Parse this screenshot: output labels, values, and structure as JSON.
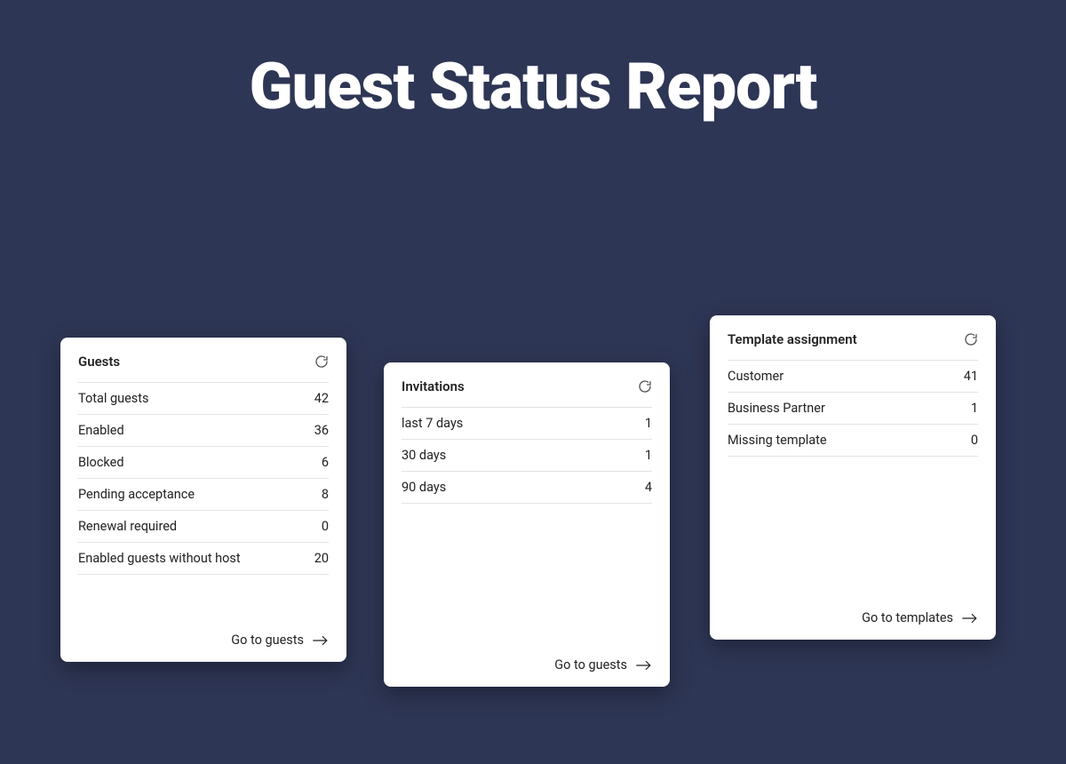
{
  "title": "Guest Status Report",
  "cards": {
    "guests": {
      "title": "Guests",
      "rows": [
        {
          "label": "Total guests",
          "value": "42"
        },
        {
          "label": "Enabled",
          "value": "36"
        },
        {
          "label": "Blocked",
          "value": "6"
        },
        {
          "label": "Pending acceptance",
          "value": "8"
        },
        {
          "label": "Renewal required",
          "value": "0"
        },
        {
          "label": "Enabled guests without host",
          "value": "20"
        }
      ],
      "link": "Go to guests"
    },
    "invitations": {
      "title": "Invitations",
      "rows": [
        {
          "label": "last 7 days",
          "value": "1"
        },
        {
          "label": "30 days",
          "value": "1"
        },
        {
          "label": "90 days",
          "value": "4"
        }
      ],
      "link": "Go to guests"
    },
    "templates": {
      "title": "Template assignment",
      "rows": [
        {
          "label": "Customer",
          "value": "41"
        },
        {
          "label": "Business Partner",
          "value": "1"
        },
        {
          "label": "Missing template",
          "value": "0"
        }
      ],
      "link": "Go to templates"
    }
  }
}
